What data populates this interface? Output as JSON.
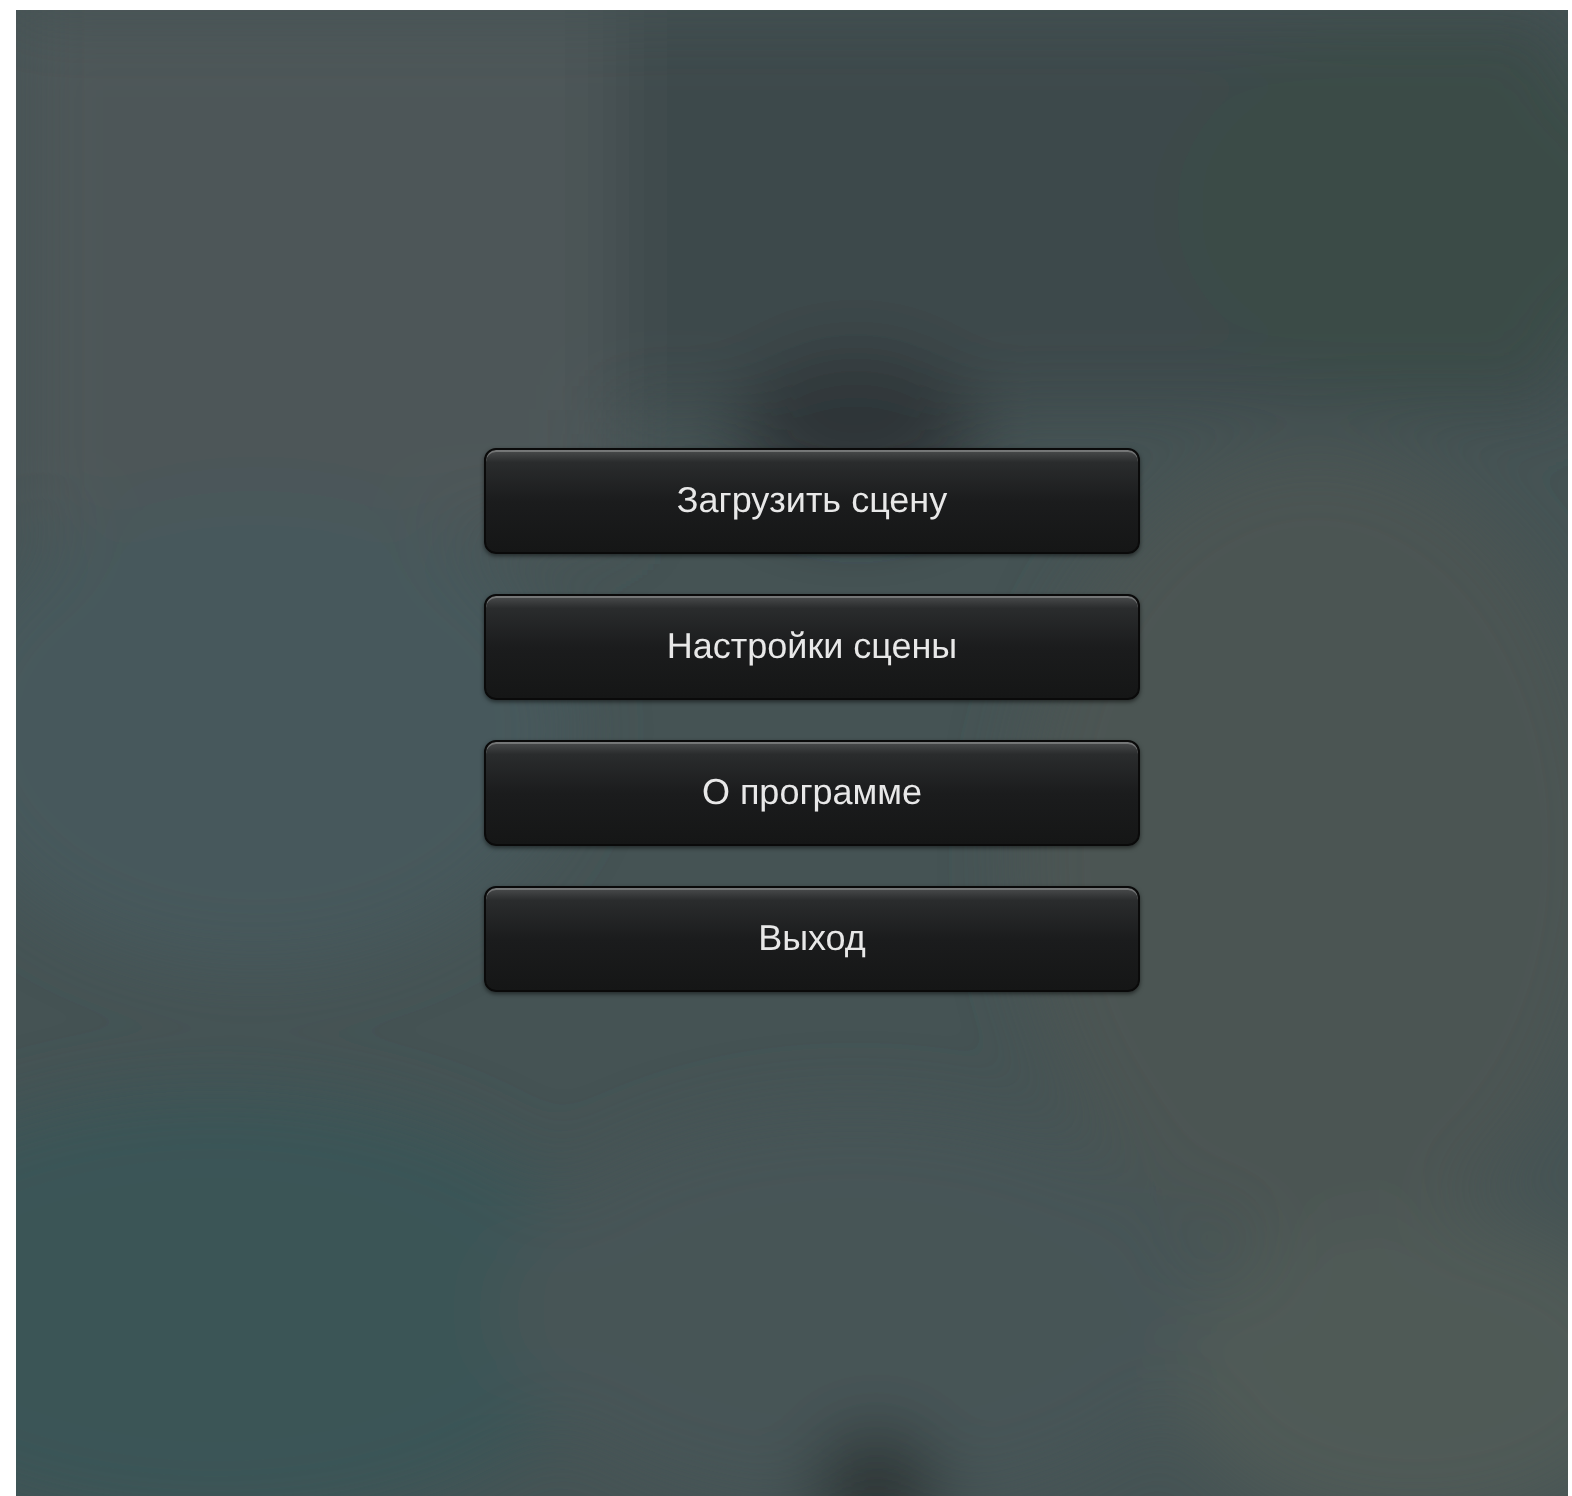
{
  "menu": [
    {
      "label": "Загрузить сцену"
    },
    {
      "label": "Настройки сцены"
    },
    {
      "label": "О программе"
    },
    {
      "label": "Выход"
    }
  ]
}
